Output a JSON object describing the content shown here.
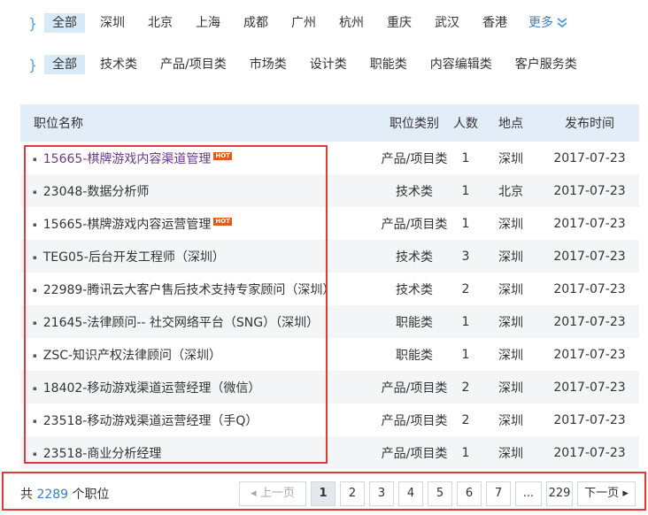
{
  "filters": {
    "locations": [
      "全部",
      "深圳",
      "北京",
      "上海",
      "成都",
      "广州",
      "杭州",
      "重庆",
      "武汉",
      "香港"
    ],
    "categories": [
      "全部",
      "技术类",
      "产品/项目类",
      "市场类",
      "设计类",
      "职能类",
      "内容编辑类",
      "客户服务类"
    ],
    "more_label": "更多",
    "brace_glyph": "}"
  },
  "table": {
    "headers": {
      "name": "职位名称",
      "category": "职位类别",
      "count": "人数",
      "location": "地点",
      "date": "发布时间"
    },
    "rows": [
      {
        "name": "15665-棋牌游戏内容渠道管理",
        "hot": true,
        "visited": true,
        "category": "产品/项目类",
        "count": "1",
        "location": "深圳",
        "date": "2017-07-23"
      },
      {
        "name": "23048-数据分析师",
        "hot": false,
        "visited": false,
        "category": "技术类",
        "count": "1",
        "location": "北京",
        "date": "2017-07-23"
      },
      {
        "name": "15665-棋牌游戏内容运营管理",
        "hot": true,
        "visited": false,
        "category": "产品/项目类",
        "count": "1",
        "location": "深圳",
        "date": "2017-07-23"
      },
      {
        "name": "TEG05-后台开发工程师（深圳）",
        "hot": false,
        "visited": false,
        "category": "技术类",
        "count": "3",
        "location": "深圳",
        "date": "2017-07-23"
      },
      {
        "name": "22989-腾讯云大客户售后技术支持专家顾问（深圳）",
        "hot": false,
        "visited": false,
        "category": "技术类",
        "count": "2",
        "location": "深圳",
        "date": "2017-07-23"
      },
      {
        "name": "21645-法律顾问-- 社交网络平台（SNG）（深圳）",
        "hot": false,
        "visited": false,
        "category": "职能类",
        "count": "1",
        "location": "深圳",
        "date": "2017-07-23"
      },
      {
        "name": "ZSC-知识产权法律顾问（深圳）",
        "hot": false,
        "visited": false,
        "category": "职能类",
        "count": "1",
        "location": "深圳",
        "date": "2017-07-23"
      },
      {
        "name": "18402-移动游戏渠道运营经理（微信）",
        "hot": false,
        "visited": false,
        "category": "产品/项目类",
        "count": "2",
        "location": "深圳",
        "date": "2017-07-23"
      },
      {
        "name": "23518-移动游戏渠道运营经理（手Q）",
        "hot": false,
        "visited": false,
        "category": "产品/项目类",
        "count": "2",
        "location": "深圳",
        "date": "2017-07-23"
      },
      {
        "name": "23518-商业分析经理",
        "hot": false,
        "visited": false,
        "category": "产品/项目类",
        "count": "1",
        "location": "深圳",
        "date": "2017-07-23"
      }
    ],
    "hot_badge": "HOT"
  },
  "footer": {
    "total_prefix": "共",
    "total_count": "2289",
    "total_suffix": "个职位",
    "prev_label": "上一页",
    "next_label": "下一页",
    "pages": [
      "1",
      "2",
      "3",
      "4",
      "5",
      "6",
      "7",
      "...",
      "229"
    ],
    "active_page": "1"
  },
  "colors": {
    "accent": "#3a7fc4",
    "highlight": "#e03a3a",
    "hot": "#e45a1d"
  }
}
